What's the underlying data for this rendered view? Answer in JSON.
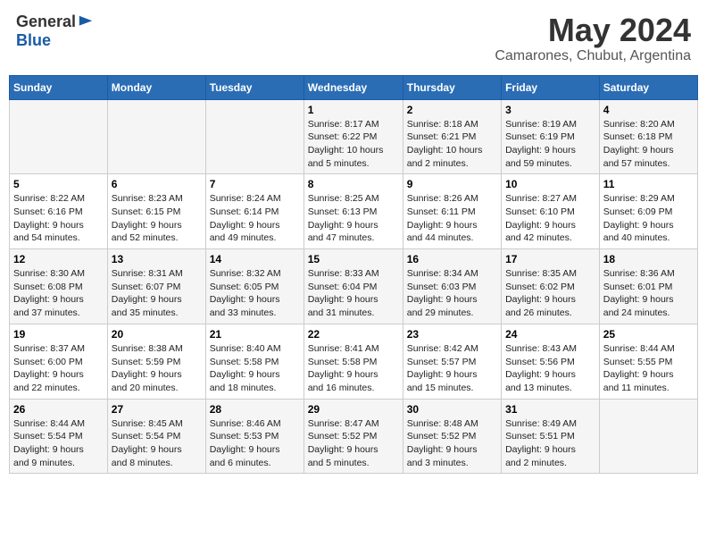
{
  "logo": {
    "general": "General",
    "blue": "Blue"
  },
  "title": "May 2024",
  "subtitle": "Camarones, Chubut, Argentina",
  "weekdays": [
    "Sunday",
    "Monday",
    "Tuesday",
    "Wednesday",
    "Thursday",
    "Friday",
    "Saturday"
  ],
  "weeks": [
    [
      {
        "day": "",
        "info": ""
      },
      {
        "day": "",
        "info": ""
      },
      {
        "day": "",
        "info": ""
      },
      {
        "day": "1",
        "info": "Sunrise: 8:17 AM\nSunset: 6:22 PM\nDaylight: 10 hours\nand 5 minutes."
      },
      {
        "day": "2",
        "info": "Sunrise: 8:18 AM\nSunset: 6:21 PM\nDaylight: 10 hours\nand 2 minutes."
      },
      {
        "day": "3",
        "info": "Sunrise: 8:19 AM\nSunset: 6:19 PM\nDaylight: 9 hours\nand 59 minutes."
      },
      {
        "day": "4",
        "info": "Sunrise: 8:20 AM\nSunset: 6:18 PM\nDaylight: 9 hours\nand 57 minutes."
      }
    ],
    [
      {
        "day": "5",
        "info": "Sunrise: 8:22 AM\nSunset: 6:16 PM\nDaylight: 9 hours\nand 54 minutes."
      },
      {
        "day": "6",
        "info": "Sunrise: 8:23 AM\nSunset: 6:15 PM\nDaylight: 9 hours\nand 52 minutes."
      },
      {
        "day": "7",
        "info": "Sunrise: 8:24 AM\nSunset: 6:14 PM\nDaylight: 9 hours\nand 49 minutes."
      },
      {
        "day": "8",
        "info": "Sunrise: 8:25 AM\nSunset: 6:13 PM\nDaylight: 9 hours\nand 47 minutes."
      },
      {
        "day": "9",
        "info": "Sunrise: 8:26 AM\nSunset: 6:11 PM\nDaylight: 9 hours\nand 44 minutes."
      },
      {
        "day": "10",
        "info": "Sunrise: 8:27 AM\nSunset: 6:10 PM\nDaylight: 9 hours\nand 42 minutes."
      },
      {
        "day": "11",
        "info": "Sunrise: 8:29 AM\nSunset: 6:09 PM\nDaylight: 9 hours\nand 40 minutes."
      }
    ],
    [
      {
        "day": "12",
        "info": "Sunrise: 8:30 AM\nSunset: 6:08 PM\nDaylight: 9 hours\nand 37 minutes."
      },
      {
        "day": "13",
        "info": "Sunrise: 8:31 AM\nSunset: 6:07 PM\nDaylight: 9 hours\nand 35 minutes."
      },
      {
        "day": "14",
        "info": "Sunrise: 8:32 AM\nSunset: 6:05 PM\nDaylight: 9 hours\nand 33 minutes."
      },
      {
        "day": "15",
        "info": "Sunrise: 8:33 AM\nSunset: 6:04 PM\nDaylight: 9 hours\nand 31 minutes."
      },
      {
        "day": "16",
        "info": "Sunrise: 8:34 AM\nSunset: 6:03 PM\nDaylight: 9 hours\nand 29 minutes."
      },
      {
        "day": "17",
        "info": "Sunrise: 8:35 AM\nSunset: 6:02 PM\nDaylight: 9 hours\nand 26 minutes."
      },
      {
        "day": "18",
        "info": "Sunrise: 8:36 AM\nSunset: 6:01 PM\nDaylight: 9 hours\nand 24 minutes."
      }
    ],
    [
      {
        "day": "19",
        "info": "Sunrise: 8:37 AM\nSunset: 6:00 PM\nDaylight: 9 hours\nand 22 minutes."
      },
      {
        "day": "20",
        "info": "Sunrise: 8:38 AM\nSunset: 5:59 PM\nDaylight: 9 hours\nand 20 minutes."
      },
      {
        "day": "21",
        "info": "Sunrise: 8:40 AM\nSunset: 5:58 PM\nDaylight: 9 hours\nand 18 minutes."
      },
      {
        "day": "22",
        "info": "Sunrise: 8:41 AM\nSunset: 5:58 PM\nDaylight: 9 hours\nand 16 minutes."
      },
      {
        "day": "23",
        "info": "Sunrise: 8:42 AM\nSunset: 5:57 PM\nDaylight: 9 hours\nand 15 minutes."
      },
      {
        "day": "24",
        "info": "Sunrise: 8:43 AM\nSunset: 5:56 PM\nDaylight: 9 hours\nand 13 minutes."
      },
      {
        "day": "25",
        "info": "Sunrise: 8:44 AM\nSunset: 5:55 PM\nDaylight: 9 hours\nand 11 minutes."
      }
    ],
    [
      {
        "day": "26",
        "info": "Sunrise: 8:44 AM\nSunset: 5:54 PM\nDaylight: 9 hours\nand 9 minutes."
      },
      {
        "day": "27",
        "info": "Sunrise: 8:45 AM\nSunset: 5:54 PM\nDaylight: 9 hours\nand 8 minutes."
      },
      {
        "day": "28",
        "info": "Sunrise: 8:46 AM\nSunset: 5:53 PM\nDaylight: 9 hours\nand 6 minutes."
      },
      {
        "day": "29",
        "info": "Sunrise: 8:47 AM\nSunset: 5:52 PM\nDaylight: 9 hours\nand 5 minutes."
      },
      {
        "day": "30",
        "info": "Sunrise: 8:48 AM\nSunset: 5:52 PM\nDaylight: 9 hours\nand 3 minutes."
      },
      {
        "day": "31",
        "info": "Sunrise: 8:49 AM\nSunset: 5:51 PM\nDaylight: 9 hours\nand 2 minutes."
      },
      {
        "day": "",
        "info": ""
      }
    ]
  ]
}
